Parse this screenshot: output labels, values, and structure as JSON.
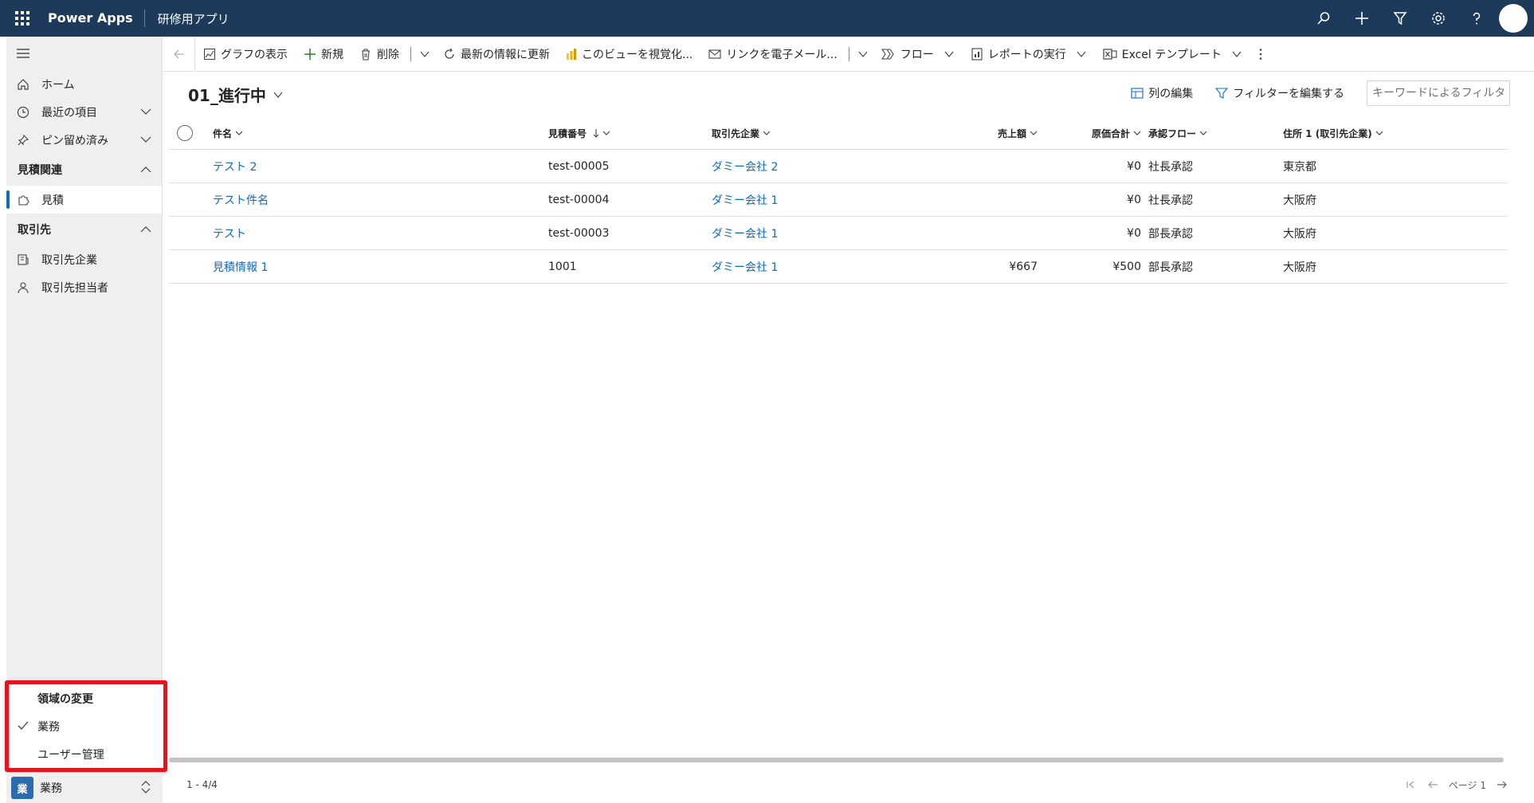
{
  "topbar": {
    "brand": "Power Apps",
    "app_name": "研修用アプリ"
  },
  "sidebar": {
    "items": [
      {
        "label": "ホーム",
        "icon": "home-icon"
      },
      {
        "label": "最近の項目",
        "icon": "clock-icon"
      },
      {
        "label": "ピン留め済み",
        "icon": "pin-icon"
      }
    ],
    "groups": [
      {
        "label": "見積関連",
        "items": [
          {
            "label": "見積",
            "icon": "puzzle-icon"
          }
        ]
      },
      {
        "label": "取引先",
        "items": [
          {
            "label": "取引先企業",
            "icon": "building-icon"
          },
          {
            "label": "取引先担当者",
            "icon": "person-icon"
          }
        ]
      }
    ]
  },
  "area_popup": {
    "header": "領域の変更",
    "items": [
      {
        "label": "業務",
        "checked": true
      },
      {
        "label": "ユーザー管理",
        "checked": false
      }
    ]
  },
  "area_switcher": {
    "badge": "業",
    "label": "業務"
  },
  "commands": {
    "chart": "グラフの表示",
    "new": "新規",
    "delete": "削除",
    "refresh": "最新の情報に更新",
    "visualize": "このビューを視覚化...",
    "email_link": "リンクを電子メール...",
    "flow": "フロー",
    "report": "レポートの実行",
    "excel": "Excel テンプレート"
  },
  "view": {
    "title": "01_進行中",
    "edit_columns": "列の編集",
    "edit_filters": "フィルターを編集する",
    "keyword_placeholder": "キーワードによるフィルタ"
  },
  "grid": {
    "headers": {
      "name": "件名",
      "quote_no": "見積番号",
      "account": "取引先企業",
      "revenue": "売上額",
      "cost": "原価合計",
      "flow": "承認フロー",
      "address": "住所 1 (取引先企業)"
    },
    "rows": [
      {
        "name": "テスト 2",
        "quote_no": "test-00005",
        "account": "ダミー会社 2",
        "revenue": "",
        "cost": "¥0",
        "flow": "社長承認",
        "address": "東京都"
      },
      {
        "name": "テスト件名",
        "quote_no": "test-00004",
        "account": "ダミー会社 1",
        "revenue": "",
        "cost": "¥0",
        "flow": "社長承認",
        "address": "大阪府"
      },
      {
        "name": "テスト",
        "quote_no": "test-00003",
        "account": "ダミー会社 1",
        "revenue": "",
        "cost": "¥0",
        "flow": "部長承認",
        "address": "大阪府"
      },
      {
        "name": "見積情報 1",
        "quote_no": "1001",
        "account": "ダミー会社 1",
        "revenue": "¥667",
        "cost": "¥500",
        "flow": "部長承認",
        "address": "大阪府"
      }
    ]
  },
  "footer": {
    "count": "1 - 4/4",
    "page_label": "ページ 1"
  },
  "colors": {
    "topbar": "#1e3a5a",
    "accent": "#0f6cbd",
    "highlight_border": "#e3141c"
  }
}
